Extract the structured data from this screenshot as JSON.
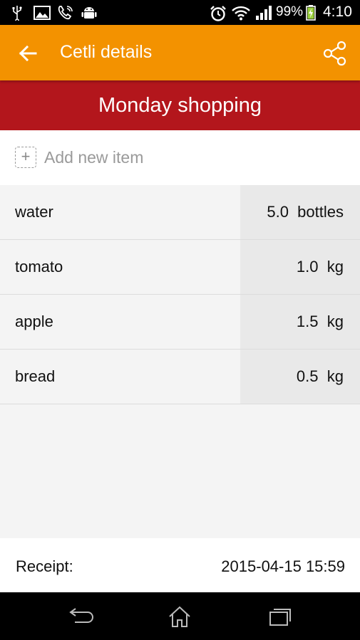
{
  "status_bar": {
    "battery_percent": "99%",
    "time": "4:10",
    "icons": [
      "usb-icon",
      "image-icon",
      "call-icon",
      "android-icon",
      "alarm-icon",
      "wifi-icon",
      "signal-icon",
      "battery-charging-icon"
    ]
  },
  "app_bar": {
    "title": "Cetli details",
    "back_icon": "arrow-back-icon",
    "share_icon": "share-icon",
    "background": "#f39200"
  },
  "list_title": {
    "text": "Monday shopping",
    "background": "#b3161c"
  },
  "add_item": {
    "label": "Add new item",
    "icon": "plus-icon"
  },
  "items": [
    {
      "name": "water",
      "amount": "5.0",
      "unit": "bottles"
    },
    {
      "name": "tomato",
      "amount": "1.0",
      "unit": "kg"
    },
    {
      "name": "apple",
      "amount": "1.5",
      "unit": "kg"
    },
    {
      "name": "bread",
      "amount": "0.5",
      "unit": "kg"
    }
  ],
  "footer": {
    "label": "Receipt:",
    "value": "2015-04-15 15:59"
  },
  "nav_bar": {
    "icons": [
      "back-nav-icon",
      "home-icon",
      "recent-apps-icon"
    ]
  }
}
